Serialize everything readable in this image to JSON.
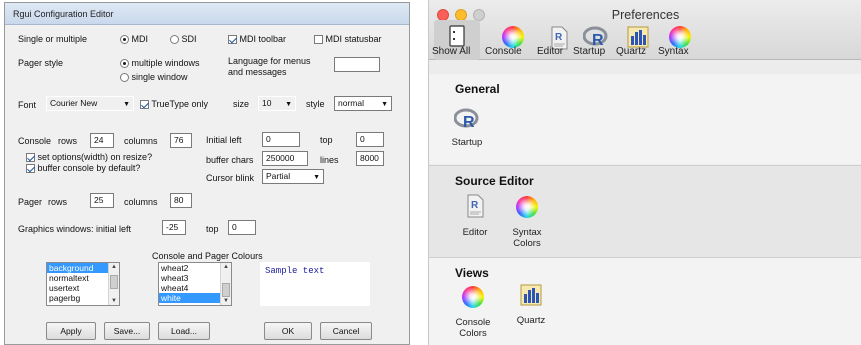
{
  "rgui": {
    "title": "Rgui Configuration Editor",
    "single_multiple_label": "Single or multiple",
    "mdi_label": "MDI",
    "sdi_label": "SDI",
    "mdi_toolbar_label": "MDI toolbar",
    "mdi_statusbar_label": "MDI statusbar",
    "pager_style_label": "Pager style",
    "multiple_windows_label": "multiple windows",
    "single_window_label": "single window",
    "language_label_line1": "Language for menus",
    "language_label_line2": "and messages",
    "language_value": "",
    "font_label": "Font",
    "font_value": "Courier New",
    "truetype_label": "TrueType only",
    "size_label": "size",
    "size_value": "10",
    "style_label": "style",
    "style_value": "normal",
    "console_label": "Console",
    "rows_label": "rows",
    "console_rows": "24",
    "columns_label": "columns",
    "console_columns": "76",
    "initial_left_label": "Initial left",
    "initial_left_value": "0",
    "top_label": "top",
    "top_value": "0",
    "set_options_label": "set options(width) on resize?",
    "buffer_console_label": "buffer console by default?",
    "buffer_chars_label": "buffer chars",
    "buffer_chars_value": "250000",
    "lines_label": "lines",
    "lines_value": "8000",
    "cursor_blink_label": "Cursor blink",
    "cursor_blink_value": "Partial",
    "pager_label": "Pager",
    "pager_rows": "25",
    "pager_columns": "80",
    "graphics_label": "Graphics windows: initial left",
    "graphics_left_value": "-25",
    "graphics_top_label": "top",
    "graphics_top_value": "0",
    "colours_label": "Console and Pager Colours",
    "colour_targets": [
      "background",
      "normaltext",
      "usertext",
      "pagerbg"
    ],
    "colour_values": [
      "wheat2",
      "wheat3",
      "wheat4",
      "white"
    ],
    "sample_text": "Sample text",
    "apply_label": "Apply",
    "save_label": "Save...",
    "load_label": "Load...",
    "ok_label": "OK",
    "cancel_label": "Cancel"
  },
  "mac": {
    "title": "Preferences",
    "toolbar": [
      "Show All",
      "Console",
      "Editor",
      "Startup",
      "Quartz",
      "Syntax"
    ],
    "general_title": "General",
    "startup_label": "Startup",
    "source_editor_title": "Source Editor",
    "editor_label": "Editor",
    "syntax_colors_line1": "Syntax",
    "syntax_colors_line2": "Colors",
    "views_title": "Views",
    "console_colors_line1": "Console",
    "console_colors_line2": "Colors",
    "quartz_label": "Quartz",
    "colors": {
      "close": "#fc5f57",
      "minimize": "#fdbc2e",
      "zoom": "#cfcfcf"
    }
  }
}
